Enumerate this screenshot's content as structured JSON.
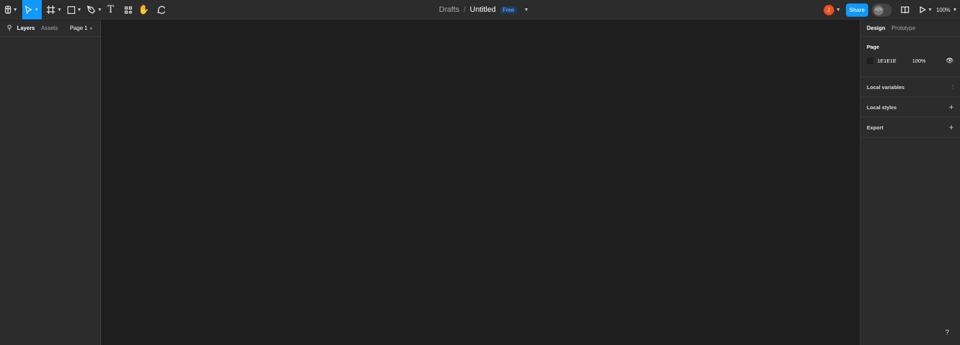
{
  "toolbar": {
    "breadcrumb_parent": "Drafts",
    "separator": "/",
    "file_name": "Untitled",
    "plan_badge": "Free",
    "avatar_initial": "J",
    "share_label": "Share",
    "zoom_level": "100%"
  },
  "left_panel": {
    "tab_layers": "Layers",
    "tab_assets": "Assets",
    "page_selector": "Page 1"
  },
  "right_panel": {
    "tab_design": "Design",
    "tab_prototype": "Prototype",
    "page_section": "Page",
    "page_color": "1E1E1E",
    "page_opacity": "100%",
    "local_variables": "Local variables",
    "local_styles": "Local styles",
    "export": "Export"
  },
  "help": "?",
  "colors": {
    "accent": "#0d99ff",
    "canvas": "#1e1e1e",
    "panel": "#2c2c2c",
    "avatar": "#f24e1e"
  }
}
